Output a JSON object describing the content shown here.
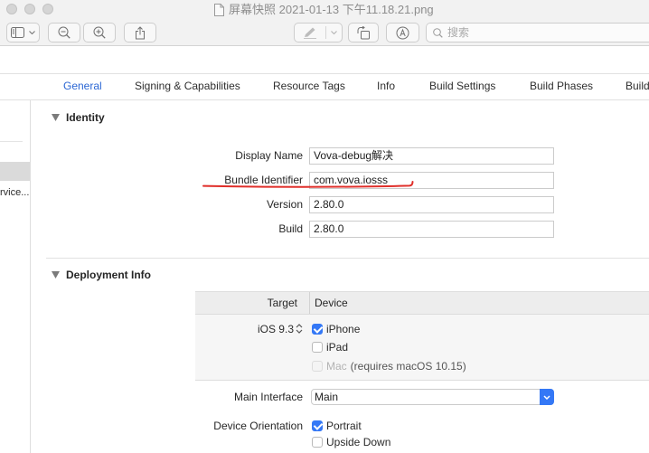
{
  "colors": {
    "accent": "#2a66d4",
    "checkbox": "#3478f6",
    "markup_red": "#e02f2a"
  },
  "window": {
    "title": "屏幕快照 2021-01-13 下午11.18.21.png",
    "search_placeholder": "搜索",
    "icons": {
      "sidebar": "sidebar-icon",
      "zoom_out": "zoom-out-icon",
      "zoom_in": "zoom-in-icon",
      "share": "share-icon",
      "markup": "pen-icon",
      "rotate": "rotate-icon",
      "annotate": "annotate-icon",
      "search": "search-icon"
    }
  },
  "tabs": [
    {
      "label": "General",
      "active": true
    },
    {
      "label": "Signing & Capabilities",
      "active": false
    },
    {
      "label": "Resource Tags",
      "active": false
    },
    {
      "label": "Info",
      "active": false
    },
    {
      "label": "Build Settings",
      "active": false
    },
    {
      "label": "Build Phases",
      "active": false
    },
    {
      "label": "Build",
      "active": false
    }
  ],
  "sidebar": {
    "items": [
      {
        "label": "rvice..."
      }
    ]
  },
  "identity": {
    "title": "Identity",
    "fields": [
      {
        "label": "Display Name",
        "value": "Vova-debug解决"
      },
      {
        "label": "Bundle Identifier",
        "value": "com.vova.iosss"
      },
      {
        "label": "Version",
        "value": "2.80.0"
      },
      {
        "label": "Build",
        "value": "2.80.0"
      }
    ]
  },
  "deployment_info": {
    "title": "Deployment Info",
    "table": {
      "headers": [
        "Target",
        "Device"
      ],
      "target": "iOS 9.3",
      "devices": [
        {
          "label": "iPhone",
          "checked": true
        },
        {
          "label": "iPad",
          "checked": false
        },
        {
          "label": "Mac",
          "note": "(requires macOS 10.15)",
          "checked": false,
          "disabled": true
        }
      ]
    },
    "main_interface": {
      "label": "Main Interface",
      "value": "Main"
    },
    "device_orientation": {
      "label": "Device Orientation",
      "options": [
        {
          "label": "Portrait",
          "checked": true
        },
        {
          "label": "Upside Down",
          "checked": false
        }
      ]
    }
  }
}
